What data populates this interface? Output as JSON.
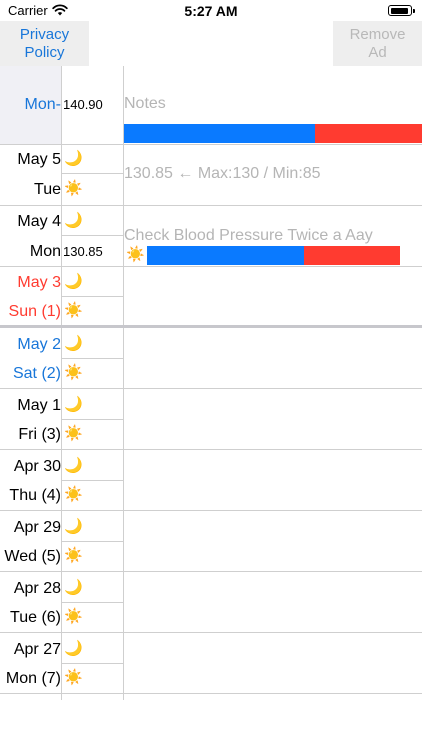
{
  "status": {
    "carrier": "Carrier",
    "time": "5:27 AM"
  },
  "toolbar": {
    "privacy_label": "Privacy\nPolicy",
    "remove_label": "Remove\nAd"
  },
  "header_row": {
    "day": "Mon-",
    "value": "140.90",
    "notes_placeholder": "Notes"
  },
  "info": {
    "max_min_text": "130.85 ← Max:130 / Min:85",
    "reminder_text": "Check Blood Pressure Twice a Aay",
    "value_mon": "130.85"
  },
  "days": [
    {
      "date": "May 5",
      "weekday": "Tue",
      "color": "black"
    },
    {
      "date": "May 4",
      "weekday": "Mon",
      "color": "black"
    },
    {
      "date": "May 3",
      "weekday": "Sun (1)",
      "color": "red"
    },
    {
      "date": "May 2",
      "weekday": "Sat (2)",
      "color": "blue"
    },
    {
      "date": "May 1",
      "weekday": "Fri (3)",
      "color": "black"
    },
    {
      "date": "Apr 30",
      "weekday": "Thu (4)",
      "color": "black"
    },
    {
      "date": "Apr 29",
      "weekday": "Wed (5)",
      "color": "black"
    },
    {
      "date": "Apr 28",
      "weekday": "Tue (6)",
      "color": "black"
    },
    {
      "date": "Apr 27",
      "weekday": "Mon (7)",
      "color": "black"
    }
  ],
  "icons": {
    "night": "🌙",
    "day": "☀️"
  },
  "colors": {
    "accent": "#1876d9",
    "bar_blue": "#0a7aff",
    "bar_red": "#ff3b30",
    "weekend_red": "#ff3b30"
  }
}
